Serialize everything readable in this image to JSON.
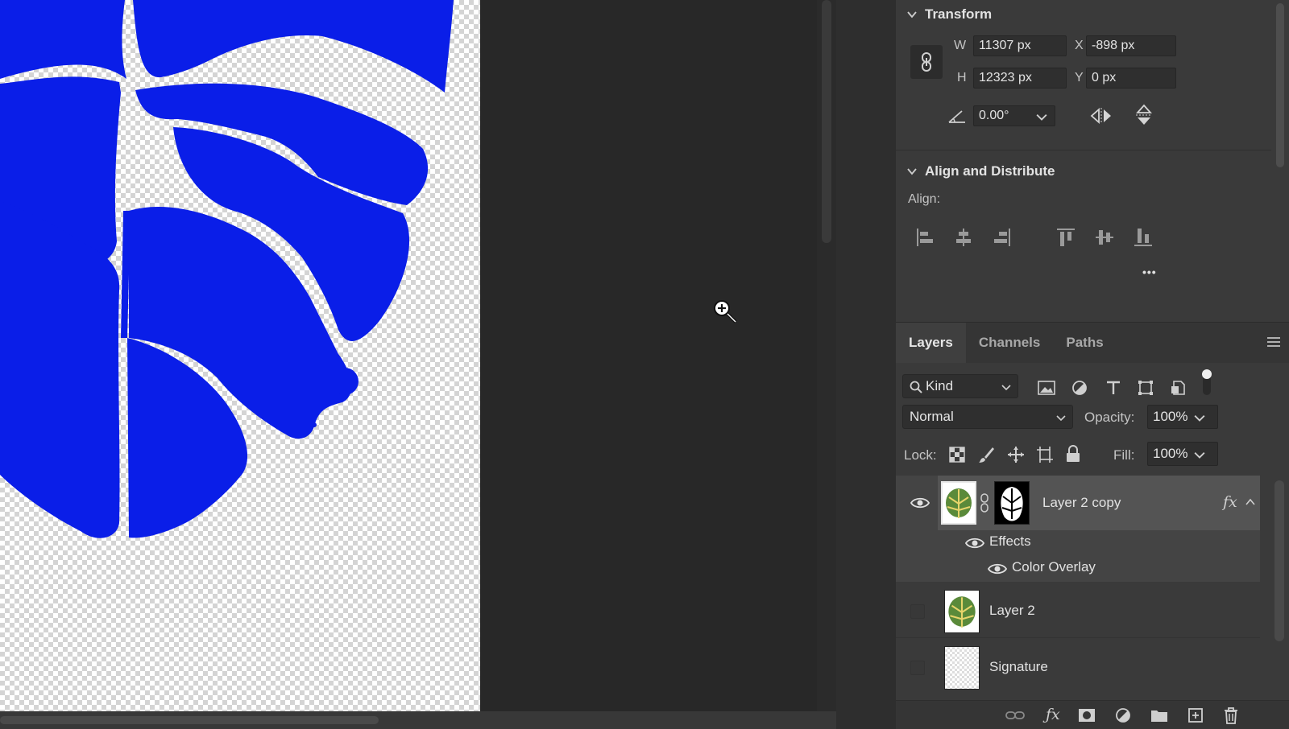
{
  "transform": {
    "title": "Transform",
    "w_label": "W",
    "w_value": "11307 px",
    "h_label": "H",
    "h_value": "12323 px",
    "x_label": "X",
    "x_value": "-898 px",
    "y_label": "Y",
    "y_value": "0 px",
    "angle_value": "0.00°"
  },
  "align": {
    "title": "Align and Distribute",
    "align_label": "Align:",
    "more": "•••"
  },
  "layers_panel": {
    "tabs": [
      "Layers",
      "Channels",
      "Paths"
    ],
    "active_tab": "Layers",
    "filter_kind": "Kind",
    "blend_mode": "Normal",
    "opacity_label": "Opacity:",
    "opacity_value": "100%",
    "lock_label": "Lock:",
    "fill_label": "Fill:",
    "fill_value": "100%",
    "layers": [
      {
        "name": "Layer 2 copy",
        "fx": "fx",
        "effects_label": "Effects",
        "effect": "Color Overlay"
      },
      {
        "name": "Layer 2"
      },
      {
        "name": "Signature"
      }
    ]
  },
  "colors": {
    "leaf_blue": "#0a1ee8",
    "panel_bg": "#3a3a3a",
    "pasteboard": "#282828"
  },
  "icons": [
    "link-icon",
    "angle-icon",
    "flip-horizontal-icon",
    "flip-vertical-icon",
    "align-left-icon",
    "align-center-icon",
    "align-right-icon",
    "align-top-icon",
    "align-middle-icon",
    "align-bottom-icon",
    "search-icon",
    "eye-icon",
    "fx-icon",
    "trash-icon",
    "zoom-in-cursor-icon"
  ]
}
